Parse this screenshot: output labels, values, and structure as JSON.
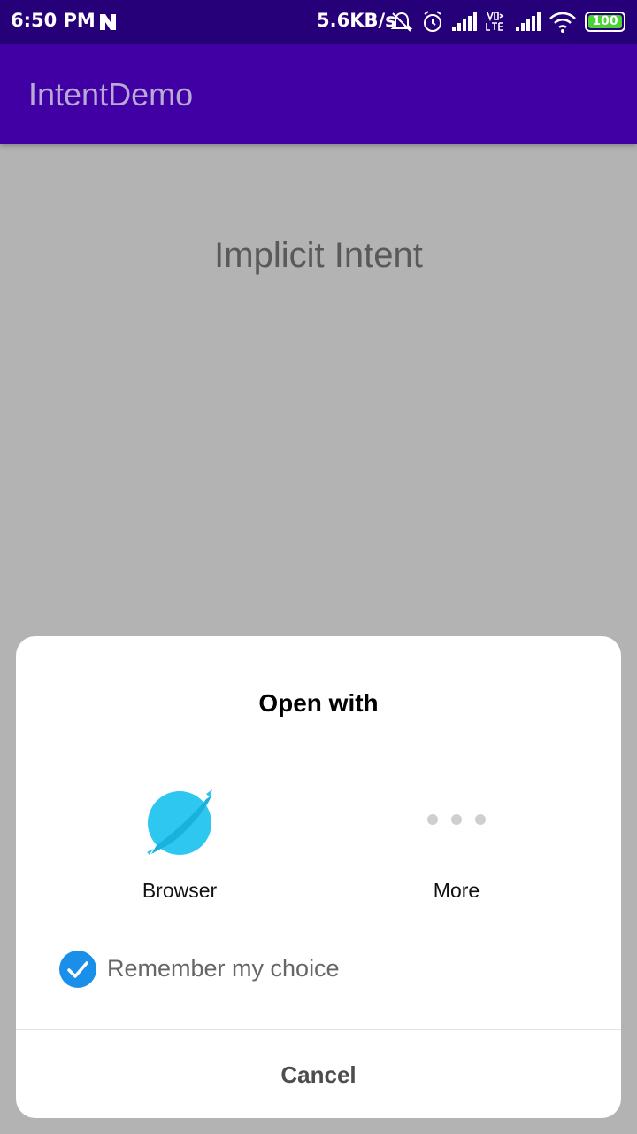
{
  "status_bar": {
    "time": "6:50 PM",
    "speed": "5.6KB/s",
    "battery": "100",
    "icons": [
      "n-notification-icon",
      "mute-bell-icon",
      "alarm-icon",
      "signal-icon",
      "volte-icon",
      "signal-icon",
      "wifi-icon",
      "battery-icon"
    ]
  },
  "app_bar": {
    "title": "IntentDemo"
  },
  "main": {
    "text": "Implicit Intent"
  },
  "dialog": {
    "title": "Open with",
    "options": [
      {
        "label": "Browser",
        "icon": "browser-icon"
      },
      {
        "label": "More",
        "icon": "more-dots-icon"
      }
    ],
    "remember_label": "Remember my choice",
    "remember_checked": true,
    "cancel_label": "Cancel"
  },
  "colors": {
    "status_bar": "#260078",
    "app_bar": "#4100a3",
    "overlay": "#b3b3b3",
    "checkbox": "#1a8fea",
    "browser": "#2ec7f0"
  }
}
